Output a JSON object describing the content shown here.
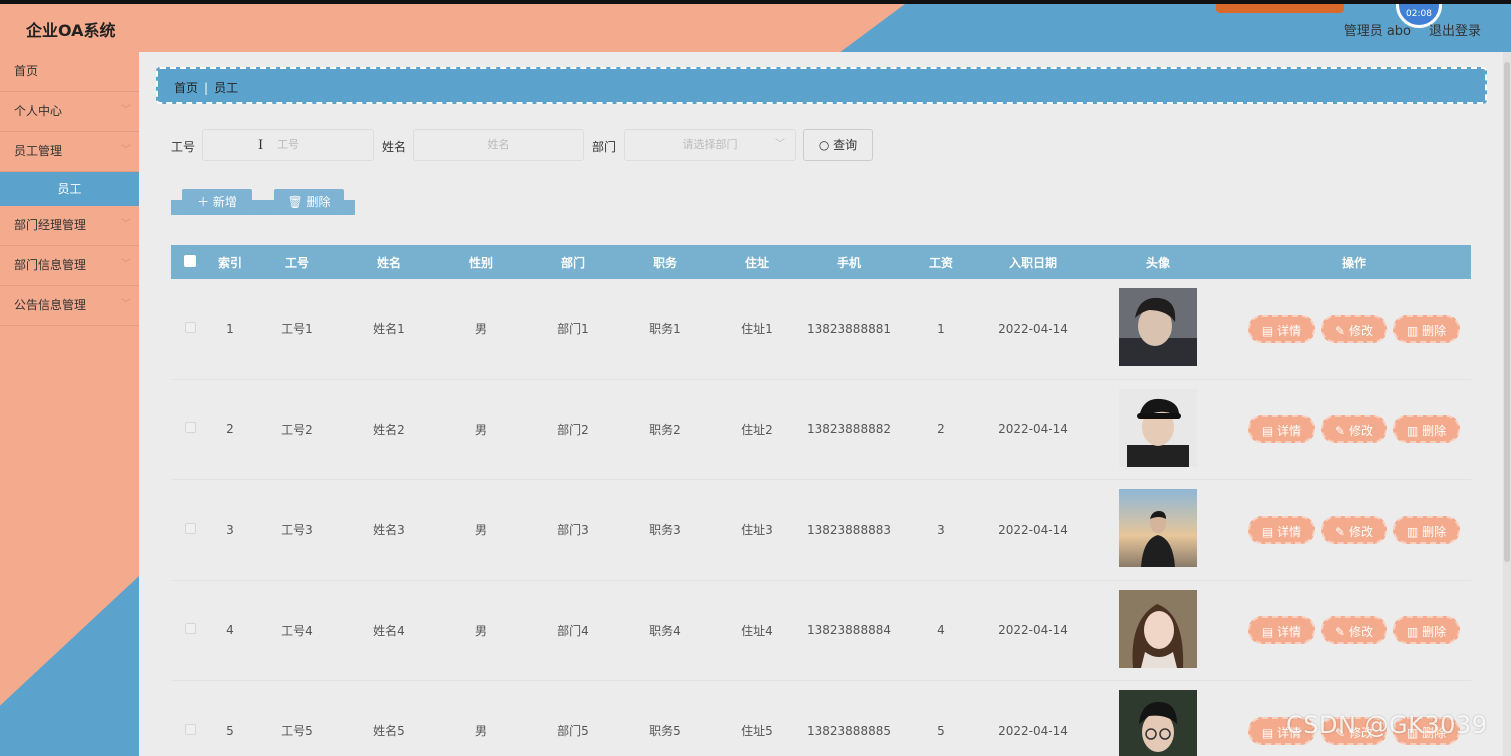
{
  "app": {
    "title": "企业OA系统"
  },
  "header": {
    "user": "管理员 abo",
    "logout": "退出登录",
    "overlay_time": "02:08"
  },
  "sidebar": {
    "items": [
      {
        "label": "首页",
        "has_chevron": false
      },
      {
        "label": "个人中心",
        "has_chevron": true
      },
      {
        "label": "员工管理",
        "has_chevron": true
      },
      {
        "label": "部门经理管理",
        "has_chevron": true
      },
      {
        "label": "部门信息管理",
        "has_chevron": true
      },
      {
        "label": "公告信息管理",
        "has_chevron": true
      }
    ],
    "active_sub": "员工"
  },
  "breadcrumb": {
    "home": "首页",
    "current": "员工"
  },
  "search": {
    "job_no_label": "工号",
    "job_no_placeholder": "工号",
    "name_label": "姓名",
    "name_placeholder": "姓名",
    "dept_label": "部门",
    "dept_placeholder": "请选择部门",
    "search_button": "查询"
  },
  "actions": {
    "add": "新增",
    "delete": "删除"
  },
  "table": {
    "headers": [
      "索引",
      "工号",
      "姓名",
      "性别",
      "部门",
      "职务",
      "住址",
      "手机",
      "工资",
      "入职日期",
      "头像",
      "操作"
    ],
    "rows": [
      {
        "index": "1",
        "job_no": "工号1",
        "name": "姓名1",
        "gender": "男",
        "dept": "部门1",
        "position": "职务1",
        "address": "住址1",
        "phone": "13823888881",
        "salary": "1",
        "date": "2022-04-14"
      },
      {
        "index": "2",
        "job_no": "工号2",
        "name": "姓名2",
        "gender": "男",
        "dept": "部门2",
        "position": "职务2",
        "address": "住址2",
        "phone": "13823888882",
        "salary": "2",
        "date": "2022-04-14"
      },
      {
        "index": "3",
        "job_no": "工号3",
        "name": "姓名3",
        "gender": "男",
        "dept": "部门3",
        "position": "职务3",
        "address": "住址3",
        "phone": "13823888883",
        "salary": "3",
        "date": "2022-04-14"
      },
      {
        "index": "4",
        "job_no": "工号4",
        "name": "姓名4",
        "gender": "男",
        "dept": "部门4",
        "position": "职务4",
        "address": "住址4",
        "phone": "13823888884",
        "salary": "4",
        "date": "2022-04-14"
      },
      {
        "index": "5",
        "job_no": "工号5",
        "name": "姓名5",
        "gender": "男",
        "dept": "部门5",
        "position": "职务5",
        "address": "住址5",
        "phone": "13823888885",
        "salary": "5",
        "date": "2022-04-14"
      }
    ],
    "row_actions": {
      "detail": "详情",
      "edit": "修改",
      "delete": "删除"
    }
  },
  "watermark": "CSDN @GK3039",
  "colors": {
    "peach": "#f4aa8c",
    "blue": "#5ba3cc",
    "table_header": "#78b0d0"
  }
}
